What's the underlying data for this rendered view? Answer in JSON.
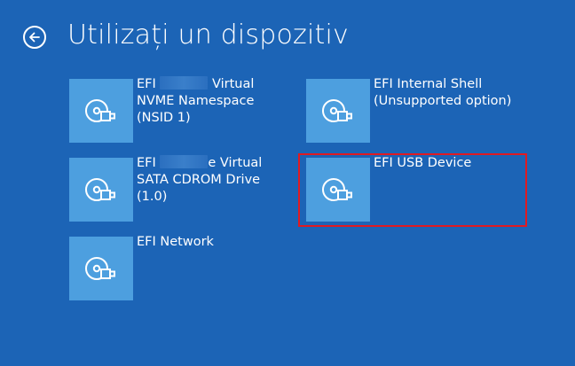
{
  "header": {
    "title": "Utilizați un dispozitiv",
    "back_icon": "back-arrow-icon"
  },
  "colors": {
    "background": "#1c64b6",
    "tile": "#4d9fdf",
    "highlight": "#e01a22"
  },
  "tiles": [
    {
      "label_prefix": "EFI",
      "label_rest": " Virtual\nNVME Namespace\n(NSID 1)",
      "icon": "disc-usb-icon",
      "redacted": true
    },
    {
      "label_prefix": "EFI",
      "label_rest": "e Virtual\nSATA CDROM Drive\n(1.0)",
      "icon": "disc-usb-icon",
      "redacted": true
    },
    {
      "label": "EFI Network",
      "icon": "disc-usb-icon"
    },
    {
      "label": "EFI Internal Shell\n(Unsupported option)",
      "icon": "disc-usb-icon"
    },
    {
      "label": "EFI USB Device",
      "icon": "disc-usb-icon",
      "highlighted": true
    }
  ]
}
